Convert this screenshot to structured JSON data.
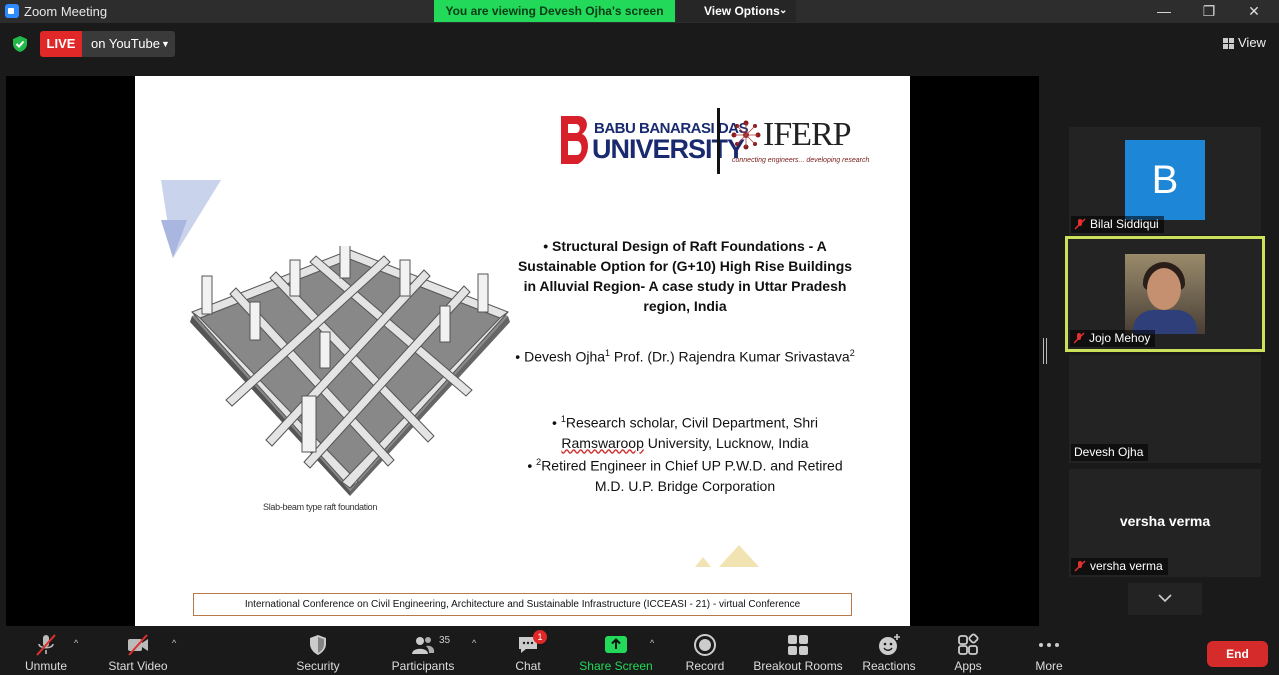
{
  "window": {
    "title": "Zoom Meeting",
    "viewing_banner": "You are viewing Devesh Ojha's screen",
    "view_options": "View Options",
    "minimize": "—",
    "maximize": "❐",
    "close": "✕"
  },
  "header": {
    "live_label": "LIVE",
    "live_destination": "on YouTube",
    "view_label": "View"
  },
  "slide": {
    "logo_bbd_line1": "BABU BANARASI DAS",
    "logo_bbd_line2": "UNIVERSITY",
    "logo_iferp_name": "IFERP",
    "logo_iferp_tag": "connecting engineers... developing research",
    "title": "• Structural Design of Raft Foundations - A Sustainable Option for (G+10) High Rise Buildings in Alluvial Region- A case study in Uttar Pradesh region, India",
    "authors_pre": "• Devesh Ojha",
    "authors_sup1": "1",
    "authors_mid": " Prof. (Dr.) Rajendra Kumar Srivastava",
    "authors_sup2": "2",
    "aff1_pre": "• ",
    "aff1_sup": "1",
    "aff1_a": "Research scholar, Civil Department, Shri ",
    "aff1_squig": "Ramswaroop",
    "aff1_b": " University, Lucknow, India",
    "aff2_pre": "• ",
    "aff2_sup": "2",
    "aff2_text": "Retired Engineer in Chief UP P.W.D. and Retired M.D. U.P. Bridge Corporation",
    "image_caption": "Slab-beam type raft foundation",
    "footer": "International Conference on Civil Engineering, Architecture and Sustainable Infrastructure (ICCEASI - 21) - virtual Conference"
  },
  "participants": [
    {
      "name": "Bilal Siddiqui",
      "avatar_letter": "B",
      "muted": true
    },
    {
      "name": "Jojo Mehoy",
      "muted": true,
      "active_speaker": true
    },
    {
      "name": "Devesh Ojha",
      "muted": false
    },
    {
      "name": "versha verma",
      "display_name": "versha verma",
      "muted": true
    }
  ],
  "toolbar": {
    "unmute": "Unmute",
    "start_video": "Start Video",
    "security": "Security",
    "participants": "Participants",
    "participants_count": "35",
    "chat": "Chat",
    "chat_badge": "1",
    "share_screen": "Share Screen",
    "record": "Record",
    "breakout_rooms": "Breakout Rooms",
    "reactions": "Reactions",
    "apps": "Apps",
    "more": "More",
    "end": "End"
  },
  "colors": {
    "live_red": "#e02828",
    "banner_green": "#23d959",
    "share_green": "#23d959",
    "speaker_border": "#cde05a",
    "avatar_blue": "#1d86d6",
    "end_red": "#d52b2b"
  },
  "icons": [
    "zoom-app-icon",
    "shield-check-icon",
    "grid-view-icon",
    "mic-muted-icon",
    "video-off-icon",
    "security-shield-icon",
    "participants-icon",
    "chat-icon",
    "share-screen-icon",
    "record-icon",
    "breakout-rooms-icon",
    "reactions-icon",
    "apps-icon",
    "more-icon",
    "chevron-down-icon"
  ]
}
